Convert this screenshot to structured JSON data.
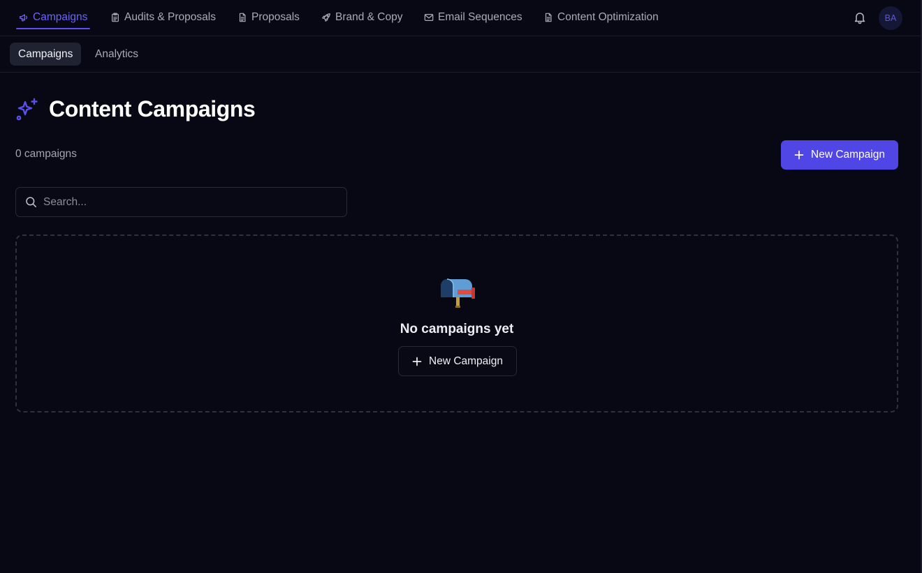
{
  "nav": {
    "items": [
      {
        "label": "Campaigns",
        "icon": "megaphone-icon",
        "active": true
      },
      {
        "label": "Audits & Proposals",
        "icon": "clipboard-icon"
      },
      {
        "label": "Proposals",
        "icon": "document-icon"
      },
      {
        "label": "Brand & Copy",
        "icon": "rocket-icon"
      },
      {
        "label": "Email Sequences",
        "icon": "mail-icon"
      },
      {
        "label": "Content Optimization",
        "icon": "document-icon"
      }
    ],
    "avatar_initials": "BA",
    "accent_color": "#5b50ee"
  },
  "subnav": {
    "tabs": [
      {
        "label": "Campaigns",
        "active": true
      },
      {
        "label": "Analytics"
      }
    ]
  },
  "header": {
    "title": "Content Campaigns",
    "icon": "sparkles-icon",
    "count_text": "0 campaigns",
    "new_button_label": "New Campaign"
  },
  "search": {
    "placeholder": "Search...",
    "value": ""
  },
  "empty_state": {
    "icon": "mailbox-icon",
    "title": "No campaigns yet",
    "button_label": "New Campaign"
  }
}
